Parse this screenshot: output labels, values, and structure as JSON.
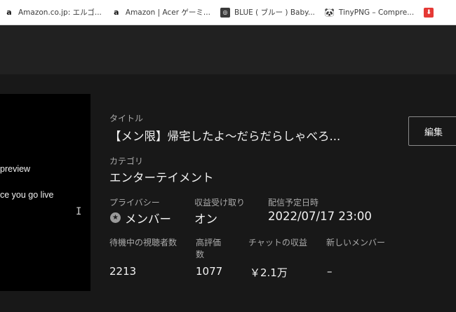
{
  "bookmarks": [
    {
      "icon": "amazon-icon",
      "glyph": "a",
      "label": "Amazon.co.jp: エルゴ..."
    },
    {
      "icon": "amazon-icon",
      "glyph": "a",
      "label": "Amazon | Acer ゲーミ..."
    },
    {
      "icon": "blue-site-icon",
      "glyph": "◎",
      "label": "BLUE ( ブルー ) Baby..."
    },
    {
      "icon": "tinypng-icon",
      "glyph": "🐼",
      "label": "TinyPNG – Compre..."
    },
    {
      "icon": "bookmark-red-icon",
      "glyph": "⬇",
      "label": ""
    }
  ],
  "preview": {
    "line1": "preview",
    "line2": "ce you go live"
  },
  "details": {
    "title_label": "タイトル",
    "title_value": "【メン限】帰宅したよ～だらだらしゃべろ...",
    "category_label": "カテゴリ",
    "category_value": "エンターテイメント",
    "privacy_label": "プライバシー",
    "privacy_value": "メンバー",
    "monetize_label": "収益受け取り",
    "monetize_value": "オン",
    "schedule_label": "配信予定日時",
    "schedule_value": "2022/07/17 23:00",
    "waiting_label": "待機中の視聴者数",
    "waiting_value": "2213",
    "likes_label": "高評価数",
    "likes_value": "1077",
    "chat_label": "チャットの収益",
    "chat_value": "￥2.1万",
    "members_label": "新しいメンバー",
    "members_value": "–"
  },
  "edit_button": {
    "label": "編集"
  },
  "colors": {
    "background": "#181818",
    "topbar": "#212121",
    "label": "#aaaaaa",
    "text": "#f1f1f1"
  }
}
